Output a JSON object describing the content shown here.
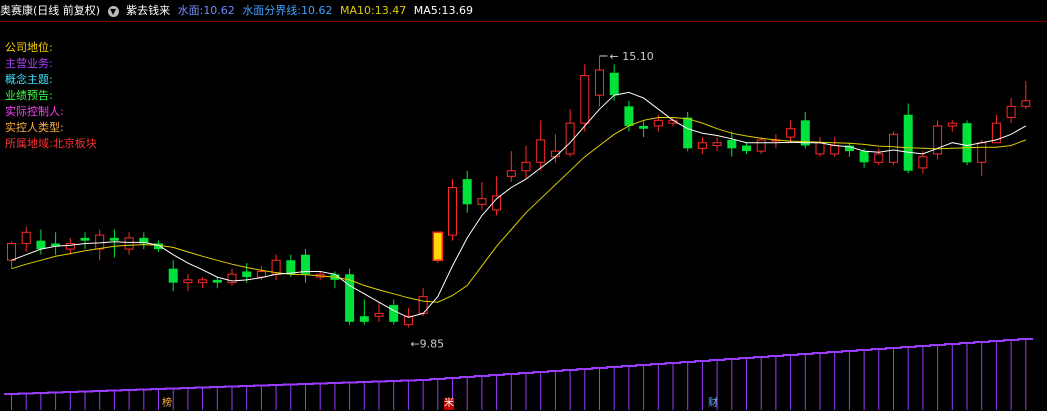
{
  "header": {
    "title": "奥赛康(日线 前复权)",
    "toggle_icon": "chevron-down-circle-icon",
    "indicator_name": "紫去钱来",
    "water_label": "水面:",
    "water_value": "10.62",
    "boundary_label": "水面分界线:",
    "boundary_value": "10.62",
    "ma10_label": "MA10:",
    "ma10_value": "13.47",
    "ma5_label": "MA5:",
    "ma5_value": "13.69"
  },
  "info": {
    "company_position": "公司地位:",
    "main_business": "主营业务:",
    "concept_theme": "概念主题:",
    "earnings_forecast": "业绩预告:",
    "actual_controller": "实际控制人:",
    "controller_type": "实控人类型:",
    "region_label": "所属地域:",
    "region_value": "北京板块"
  },
  "markers": {
    "high_label": "15.10",
    "low_label": "9.85",
    "m1": "榜",
    "m2": "米",
    "m3": "财"
  },
  "colors": {
    "up": "#ff2a2a",
    "down": "#00e13a",
    "special": "#ffd700",
    "ma5": "#ffffff",
    "ma10": "#e0d000",
    "volume": "#9a3cff",
    "water": "#4a6cff",
    "boundary": "#3fa0ff",
    "info_yellow": "#ffd700",
    "info_purple": "#b040ff",
    "info_cyan": "#40e0ff",
    "info_green": "#40ff40",
    "info_magenta": "#ff40ff",
    "info_orange": "#ffb040",
    "info_red": "#ff3030"
  },
  "chart_data": {
    "type": "candlestick",
    "price_range": [
      9.4,
      15.6
    ],
    "candles": [
      [
        11.45,
        11.75,
        11.78,
        11.3
      ],
      [
        11.75,
        11.95,
        12.05,
        11.6
      ],
      [
        11.8,
        11.65,
        12.0,
        11.55
      ],
      [
        11.75,
        11.7,
        11.95,
        11.55
      ],
      [
        11.65,
        11.75,
        11.85,
        11.55
      ],
      [
        11.85,
        11.8,
        11.95,
        11.65
      ],
      [
        11.65,
        11.9,
        12.0,
        11.45
      ],
      [
        11.85,
        11.8,
        12.0,
        11.5
      ],
      [
        11.65,
        11.85,
        11.95,
        11.55
      ],
      [
        11.85,
        11.75,
        11.95,
        11.65
      ],
      [
        11.75,
        11.65,
        11.8,
        11.6
      ],
      [
        11.3,
        11.05,
        11.45,
        10.9
      ],
      [
        11.05,
        11.1,
        11.2,
        10.9
      ],
      [
        11.05,
        11.1,
        11.15,
        10.95
      ],
      [
        11.1,
        11.05,
        11.15,
        10.95
      ],
      [
        11.05,
        11.2,
        11.3,
        11.0
      ],
      [
        11.25,
        11.15,
        11.4,
        11.05
      ],
      [
        11.15,
        11.25,
        11.35,
        11.1
      ],
      [
        11.2,
        11.45,
        11.55,
        11.1
      ],
      [
        11.45,
        11.2,
        11.55,
        11.15
      ],
      [
        11.55,
        11.2,
        11.65,
        11.05
      ],
      [
        11.15,
        11.2,
        11.25,
        11.1
      ],
      [
        11.2,
        11.1,
        11.25,
        10.95
      ],
      [
        11.2,
        10.35,
        11.3,
        10.3
      ],
      [
        10.45,
        10.35,
        10.75,
        10.3
      ],
      [
        10.45,
        10.5,
        10.7,
        10.35
      ],
      [
        10.65,
        10.35,
        10.75,
        10.3
      ],
      [
        10.3,
        10.45,
        10.6,
        10.25
      ],
      [
        10.5,
        10.8,
        10.95,
        10.45
      ],
      [
        11.45,
        11.95,
        11.95,
        11.4
      ],
      [
        11.9,
        12.75,
        12.9,
        11.8
      ],
      [
        12.9,
        12.45,
        13.05,
        12.3
      ],
      [
        12.45,
        12.55,
        12.85,
        12.35
      ],
      [
        12.35,
        12.6,
        12.95,
        12.25
      ],
      [
        12.95,
        13.05,
        13.4,
        12.85
      ],
      [
        13.05,
        13.2,
        13.5,
        12.9
      ],
      [
        13.2,
        13.6,
        13.95,
        13.05
      ],
      [
        13.3,
        13.4,
        13.7,
        13.2
      ],
      [
        13.35,
        13.9,
        14.15,
        13.3
      ],
      [
        13.9,
        14.75,
        14.95,
        13.75
      ],
      [
        14.4,
        14.85,
        15.1,
        14.2
      ],
      [
        14.8,
        14.4,
        14.95,
        14.3
      ],
      [
        14.2,
        13.85,
        14.3,
        13.75
      ],
      [
        13.85,
        13.8,
        13.95,
        13.65
      ],
      [
        13.85,
        13.95,
        14.05,
        13.75
      ],
      [
        13.9,
        13.95,
        14.0,
        13.85
      ],
      [
        14.0,
        13.45,
        14.1,
        13.4
      ],
      [
        13.45,
        13.55,
        13.65,
        13.35
      ],
      [
        13.5,
        13.55,
        13.65,
        13.4
      ],
      [
        13.6,
        13.45,
        13.75,
        13.3
      ],
      [
        13.5,
        13.4,
        13.55,
        13.35
      ],
      [
        13.4,
        13.6,
        13.65,
        13.35
      ],
      [
        13.6,
        13.6,
        13.7,
        13.45
      ],
      [
        13.65,
        13.8,
        13.95,
        13.55
      ],
      [
        13.95,
        13.5,
        14.1,
        13.45
      ],
      [
        13.35,
        13.55,
        13.65,
        13.3
      ],
      [
        13.35,
        13.5,
        13.65,
        13.3
      ],
      [
        13.5,
        13.4,
        13.55,
        13.3
      ],
      [
        13.4,
        13.2,
        13.45,
        13.1
      ],
      [
        13.2,
        13.35,
        13.45,
        13.15
      ],
      [
        13.2,
        13.7,
        13.75,
        13.15
      ],
      [
        14.05,
        13.05,
        14.25,
        13.0
      ],
      [
        13.1,
        13.3,
        13.4,
        13.0
      ],
      [
        13.35,
        13.85,
        13.95,
        13.25
      ],
      [
        13.85,
        13.9,
        13.95,
        13.75
      ],
      [
        13.9,
        13.2,
        13.95,
        13.15
      ],
      [
        13.2,
        13.55,
        13.6,
        12.95
      ],
      [
        13.55,
        13.9,
        14.05,
        13.55
      ],
      [
        14.0,
        14.2,
        14.35,
        13.9
      ],
      [
        14.2,
        14.3,
        14.65,
        14.15
      ]
    ],
    "ma5": [
      11.45,
      11.55,
      11.65,
      11.7,
      11.72,
      11.75,
      11.76,
      11.78,
      11.77,
      11.77,
      11.72,
      11.55,
      11.4,
      11.28,
      11.15,
      11.08,
      11.1,
      11.14,
      11.2,
      11.22,
      11.25,
      11.25,
      11.2,
      11.0,
      10.85,
      10.7,
      10.55,
      10.43,
      10.5,
      10.8,
      11.35,
      11.85,
      12.25,
      12.55,
      12.75,
      12.9,
      13.1,
      13.3,
      13.55,
      13.85,
      14.15,
      14.4,
      14.45,
      14.35,
      14.15,
      13.95,
      13.8,
      13.72,
      13.68,
      13.62,
      13.55,
      13.55,
      13.55,
      13.56,
      13.55,
      13.55,
      13.5,
      13.48,
      13.4,
      13.38,
      13.42,
      13.38,
      13.35,
      13.45,
      13.55,
      13.5,
      13.55,
      13.6,
      13.7,
      13.85
    ],
    "ma10": [
      11.3,
      11.38,
      11.45,
      11.52,
      11.57,
      11.62,
      11.66,
      11.7,
      11.72,
      11.73,
      11.72,
      11.68,
      11.6,
      11.52,
      11.45,
      11.38,
      11.32,
      11.27,
      11.23,
      11.2,
      11.19,
      11.17,
      11.15,
      11.1,
      11.0,
      10.92,
      10.85,
      10.78,
      10.72,
      10.7,
      10.82,
      11.0,
      11.35,
      11.7,
      12.0,
      12.3,
      12.55,
      12.8,
      13.05,
      13.3,
      13.5,
      13.7,
      13.85,
      13.95,
      14.0,
      14.0,
      13.98,
      13.9,
      13.8,
      13.72,
      13.67,
      13.63,
      13.6,
      13.58,
      13.57,
      13.56,
      13.55,
      13.54,
      13.52,
      13.49,
      13.48,
      13.46,
      13.45,
      13.44,
      13.45,
      13.46,
      13.47,
      13.47,
      13.5,
      13.6
    ],
    "special_index": 29,
    "high_index": 40,
    "low_index": 27,
    "volume_range": [
      0,
      100
    ],
    "volume": [
      16,
      16.5,
      17,
      17.5,
      18,
      18.5,
      19,
      19.5,
      20,
      20.5,
      21,
      21.5,
      22,
      22.5,
      23,
      23.5,
      24,
      24.5,
      25,
      25.5,
      26,
      26.5,
      27,
      27.5,
      28,
      28.5,
      29,
      29.5,
      30,
      31,
      32,
      33,
      34,
      35,
      36,
      37,
      38,
      39,
      40,
      41,
      42,
      43,
      44,
      45,
      46,
      47,
      48,
      49,
      50,
      51,
      52,
      53,
      54,
      55,
      56,
      57,
      58,
      59,
      60,
      61,
      62,
      63,
      64,
      65,
      66,
      67,
      68,
      69,
      70,
      71
    ]
  }
}
